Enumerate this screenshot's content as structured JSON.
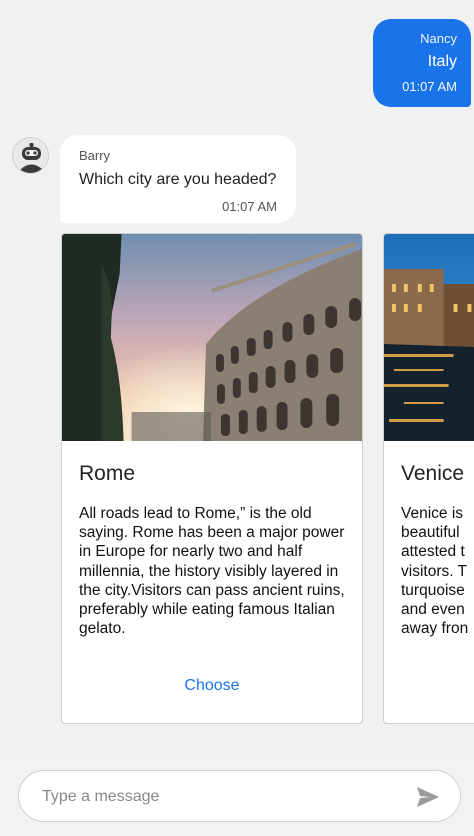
{
  "messages": {
    "outgoing": {
      "name": "Nancy",
      "text": "Italy",
      "time": "01:07 AM"
    },
    "incoming": {
      "name": "Barry",
      "text": "Which city are you headed?",
      "time": "01:07 AM",
      "avatar_icon": "robot-icon"
    }
  },
  "cards": [
    {
      "title": "Rome",
      "description": "All roads lead to Rome,” is the old saying. Rome has been a major power in Europe for nearly two and half millennia, the history visibly layered in the city.Visitors can pass ancient ruins, preferably while eating famous Italian gelato.",
      "button": "Choose",
      "image_icon": "colosseum-photo"
    },
    {
      "title": "Venice",
      "description": "Venice is\nbeautiful\nattested t\nvisitors. T\nturquoise\nand even\naway fron",
      "image_icon": "venice-canal-photo"
    }
  ],
  "composer": {
    "placeholder": "Type a message",
    "send_icon": "send-icon"
  },
  "colors": {
    "accent": "#1a73e8",
    "background": "#f1f1f1",
    "bubble_in": "#ffffff"
  }
}
